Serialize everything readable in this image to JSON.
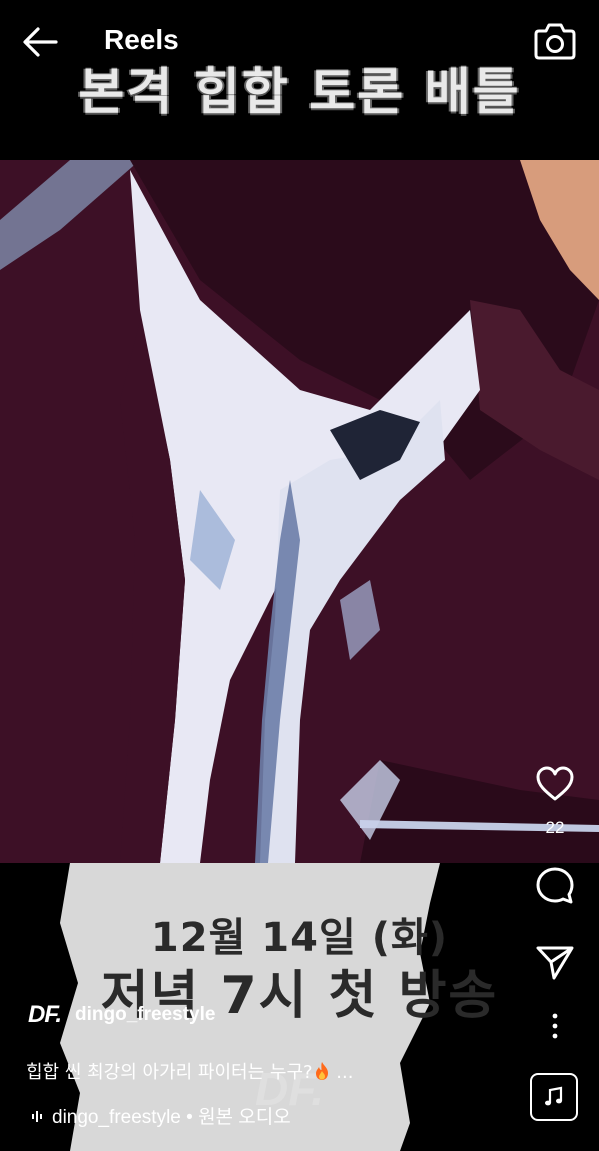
{
  "header": {
    "title": "Reels"
  },
  "video": {
    "headline": "본격 힙합 토론 배틀",
    "airdate_line1": "12월 14일 (화)",
    "airdate_line2": "저녁 7시 첫 방송",
    "watermark": "DF."
  },
  "actions": {
    "like_count": "22"
  },
  "post": {
    "logo_text": "DF.",
    "username": "dingo_freestyle",
    "caption": "힙합 씬 최강의 아가리 파이터는 누구?",
    "caption_more": " ...",
    "audio_label": "dingo_freestyle • 원본 오디오"
  },
  "icons": [
    "back-arrow-icon",
    "camera-icon",
    "heart-icon",
    "comment-icon",
    "share-icon",
    "more-icon",
    "fire-icon",
    "audio-wave-icon",
    "music-note-icon"
  ]
}
